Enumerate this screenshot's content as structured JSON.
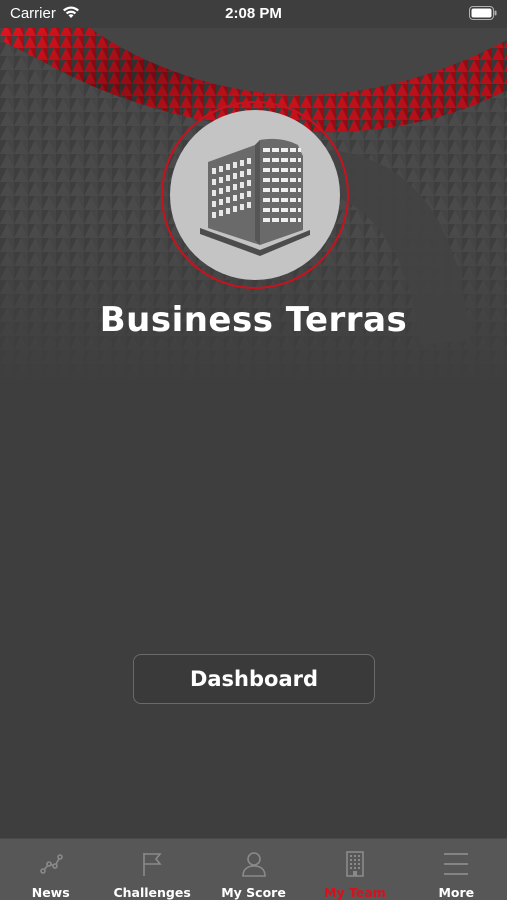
{
  "status_bar": {
    "carrier": "Carrier",
    "time": "2:08 PM"
  },
  "header": {
    "title": "Business Terras"
  },
  "main": {
    "dashboard_label": "Dashboard"
  },
  "tabbar": {
    "tabs": [
      {
        "label": "News",
        "icon": "news-icon",
        "active": false
      },
      {
        "label": "Challenges",
        "icon": "flag-icon",
        "active": false
      },
      {
        "label": "My Score",
        "icon": "person-icon",
        "active": false
      },
      {
        "label": "My Team",
        "icon": "building-icon",
        "active": true
      },
      {
        "label": "More",
        "icon": "menu-icon",
        "active": false
      }
    ]
  },
  "colors": {
    "accent": "#d8101c",
    "background": "#3e3e3e",
    "tabbar": "#575757"
  }
}
